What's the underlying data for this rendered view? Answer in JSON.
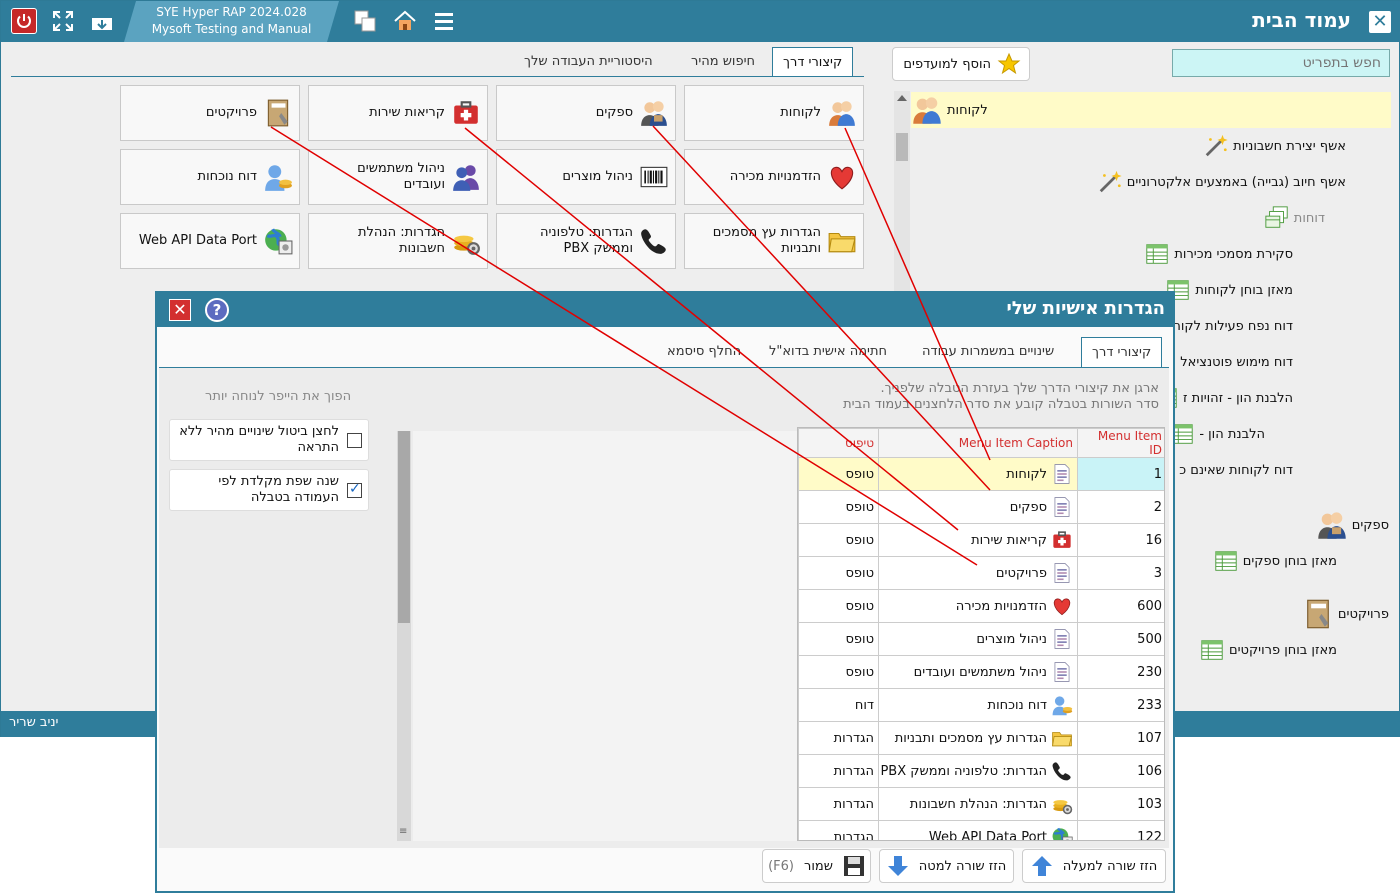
{
  "app": {
    "product_line1": "SYE  Hyper  RAP  2024.028",
    "product_line2": "Mysoft Testing and Manual",
    "page_title": "עמוד הבית",
    "user": "יניב שריר"
  },
  "tabs": [
    {
      "label": "קיצורי דרך",
      "active": true
    },
    {
      "label": "חיפוש מהיר",
      "active": false
    },
    {
      "label": "היסטוריית העבודה שלך",
      "active": false
    }
  ],
  "search": {
    "placeholder": "חפש בתפריט"
  },
  "favorites": {
    "label": "הוסף למועדפים"
  },
  "tiles": [
    {
      "label": "לקוחות",
      "icon": "users-icon"
    },
    {
      "label": "ספקים",
      "icon": "suppliers-icon"
    },
    {
      "label": "קריאות שירות",
      "icon": "first-aid-icon"
    },
    {
      "label": "פרויקטים",
      "icon": "notebook-icon"
    },
    {
      "label": "הזדמנויות מכירה",
      "icon": "heart-icon"
    },
    {
      "label": "ניהול מוצרים",
      "icon": "barcode-icon"
    },
    {
      "label": "ניהול משתמשים ועובדים",
      "icon": "group-icon"
    },
    {
      "label": "דוח נוכחות",
      "icon": "attendance-icon"
    },
    {
      "label": "הגדרות עץ מסמכים ותבניות",
      "icon": "folder-icon"
    },
    {
      "label": "הגדרות: טלפוניה וממשק PBX",
      "icon": "phone-icon"
    },
    {
      "label": "הגדרות: הנהלת חשבונות",
      "icon": "coins-gear-icon"
    },
    {
      "label": "Web API Data Port",
      "icon": "globe-icon"
    }
  ],
  "tree": [
    {
      "label": "לקוחות",
      "icon": "users-icon",
      "selected": true
    },
    {
      "label": "אשף יצירת חשבוניות",
      "icon": "wand-icon"
    },
    {
      "label": "אשף חיוב (גבייה) באמצעים אלקטרוניים",
      "icon": "wand-icon"
    },
    {
      "label": "דוחות",
      "icon": "reports-icon",
      "muted": true
    },
    {
      "label": "סקירת מסמכי מכירות",
      "icon": "table-icon"
    },
    {
      "label": "מאזן בוחן לקוחות",
      "icon": "table-icon"
    },
    {
      "label": "דוח נפח פעילות לקוחות",
      "icon": "table-icon"
    },
    {
      "label": "דוח מימוש פוטנציאל",
      "icon": "table-icon"
    },
    {
      "label": "הלבנת הון - זהויות ז",
      "icon": "table-icon"
    },
    {
      "label": "הלבנת הון -",
      "icon": "table-icon"
    },
    {
      "label": "דוח לקוחות שאינם כ",
      "icon": "table-icon"
    },
    {
      "label": "ספקים",
      "icon": "suppliers-icon"
    },
    {
      "label": "מאזן בוחן ספקים",
      "icon": "table-icon"
    },
    {
      "label": "פרויקטים",
      "icon": "notebook-icon"
    },
    {
      "label": "מאזן בוחן פרויקטים",
      "icon": "table-icon"
    }
  ],
  "dialog": {
    "title": "הגדרות אישיות שלי",
    "tabs": [
      {
        "label": "קיצורי דרך",
        "active": true
      },
      {
        "label": "שינויים במשמרות עבודה",
        "active": false
      },
      {
        "label": "חתימה אישית בדוא\"ל",
        "active": false
      },
      {
        "label": "החלף סיסמא",
        "active": false
      }
    ],
    "instruction1": "ארגן את קיצורי הדרך שלך בעזרת הטבלה שלפניך.",
    "instruction2": "סדר השורות בטבלה קובע את סדר הלחצנים בעמוד הבית",
    "hint": "הפוך את הייפר לנוחה יותר",
    "options": [
      {
        "label": "לחצן ביטול שינויים מהיר ללא התראה",
        "checked": false
      },
      {
        "label": "שנה שפת מקלדת לפי העמודה בטבלה",
        "checked": true
      }
    ],
    "columns": {
      "id": "Menu Item ID",
      "caption": "Menu Item Caption",
      "type": "טיפוס"
    },
    "rows": [
      {
        "id": "1",
        "caption": "לקוחות",
        "type": "טופס",
        "icon": "doc-icon",
        "selected": true
      },
      {
        "id": "2",
        "caption": "ספקים",
        "type": "טופס",
        "icon": "doc-icon"
      },
      {
        "id": "16",
        "caption": "קריאות שירות",
        "type": "טופס",
        "icon": "first-aid-icon"
      },
      {
        "id": "3",
        "caption": "פרויקטים",
        "type": "טופס",
        "icon": "doc-icon"
      },
      {
        "id": "600",
        "caption": "הזדמנויות מכירה",
        "type": "טופס",
        "icon": "heart-icon"
      },
      {
        "id": "500",
        "caption": "ניהול מוצרים",
        "type": "טופס",
        "icon": "doc-icon"
      },
      {
        "id": "230",
        "caption": "ניהול משתמשים ועובדים",
        "type": "טופס",
        "icon": "doc-icon"
      },
      {
        "id": "233",
        "caption": "דוח נוכחות",
        "type": "דוח",
        "icon": "attendance-icon"
      },
      {
        "id": "107",
        "caption": "הגדרות עץ מסמכים ותבניות",
        "type": "הגדרות",
        "icon": "folder-icon"
      },
      {
        "id": "106",
        "caption": "הגדרות: טלפוניה וממשק PBX",
        "type": "הגדרות",
        "icon": "phone-icon"
      },
      {
        "id": "103",
        "caption": "הגדרות: הנהלת חשבונות",
        "type": "הגדרות",
        "icon": "coins-gear-icon"
      },
      {
        "id": "122",
        "caption": "Web API Data Port",
        "type": "הגדרות",
        "icon": "globe-icon"
      }
    ],
    "buttons": {
      "move_up": "הזז שורה למעלה",
      "move_down": "הזז שורה למטה",
      "save": "שמור",
      "save_key": "(F6)"
    }
  },
  "colors": {
    "accent": "#2f7d9b",
    "annotation_line": "#e00000",
    "selected_row": "#fffbc8"
  }
}
